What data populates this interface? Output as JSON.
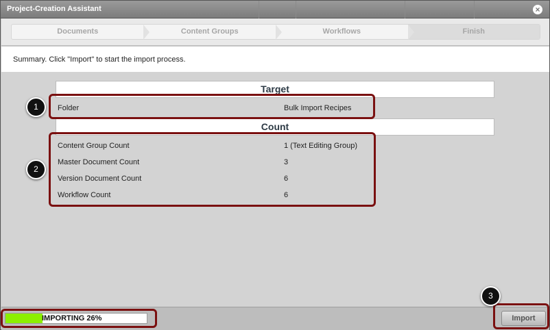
{
  "window": {
    "title": "Project-Creation Assistant",
    "close_glyph": "×"
  },
  "steps": [
    {
      "label": "Documents"
    },
    {
      "label": "Content Groups"
    },
    {
      "label": "Workflows"
    },
    {
      "label": "Finish"
    }
  ],
  "summary": {
    "text": "Summary. Click \"Import\" to start the import process."
  },
  "target": {
    "header": "Target",
    "rows": [
      {
        "label": "Folder",
        "value": "Bulk Import Recipes"
      }
    ]
  },
  "count": {
    "header": "Count",
    "rows": [
      {
        "label": "Content Group Count",
        "value": "1 (Text Editing Group)"
      },
      {
        "label": "Master Document Count",
        "value": "3"
      },
      {
        "label": "Version Document Count",
        "value": "6"
      },
      {
        "label": "Workflow Count",
        "value": "6"
      }
    ]
  },
  "markers": [
    "1",
    "2",
    "3"
  ],
  "progress": {
    "label": "IMPORTING 26%",
    "percent": 26
  },
  "footer": {
    "import_label": "Import"
  },
  "colors": {
    "highlight": "#7a1010",
    "progress_fill": "#8cf000"
  }
}
